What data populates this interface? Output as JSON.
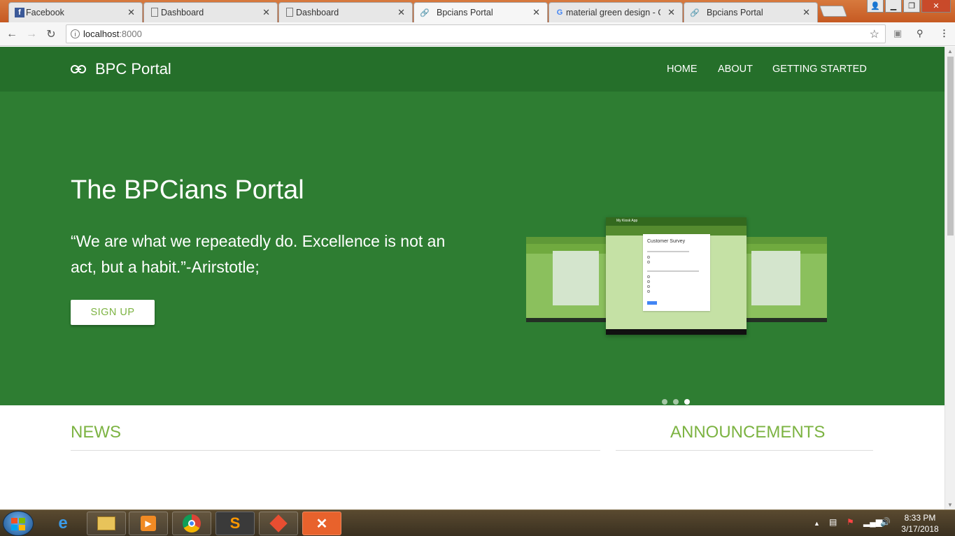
{
  "browser": {
    "tabs": [
      {
        "title": "Facebook",
        "icon": "facebook-icon"
      },
      {
        "title": "Dashboard",
        "icon": "page-icon"
      },
      {
        "title": "Dashboard",
        "icon": "page-icon"
      },
      {
        "title": "Bpcians Portal",
        "icon": "link-icon",
        "active": true
      },
      {
        "title": "material green design - G",
        "icon": "google-icon"
      },
      {
        "title": "Bpcians Portal",
        "icon": "link-icon"
      }
    ],
    "url_host": "localhost",
    "url_port": ":8000"
  },
  "site": {
    "brand": "BPC Portal",
    "nav": [
      "HOME",
      "ABOUT",
      "GETTING STARTED"
    ],
    "hero": {
      "title": "The BPCians Portal",
      "quote": "“We are what we repeatedly do. Excellence is not an act, but a habit.”-Arirstotle;",
      "button": "SIGN UP"
    },
    "carousel": {
      "card_title": "Customer Survey",
      "app_name": "My Kiosk App",
      "slides": 3,
      "active_slide": 3
    },
    "sections": {
      "news": "NEWS",
      "announcements": "ANNOUNCEMENTS"
    }
  },
  "colors": {
    "nav": "#256f2a",
    "hero": "#2e7d32",
    "accent": "#7cb342"
  },
  "taskbar": {
    "time": "8:33 PM",
    "date": "3/17/2018",
    "apps": [
      "internet-explorer-icon",
      "file-explorer-icon",
      "media-player-icon",
      "chrome-icon",
      "sublime-text-icon",
      "git-icon",
      "xampp-icon"
    ]
  }
}
